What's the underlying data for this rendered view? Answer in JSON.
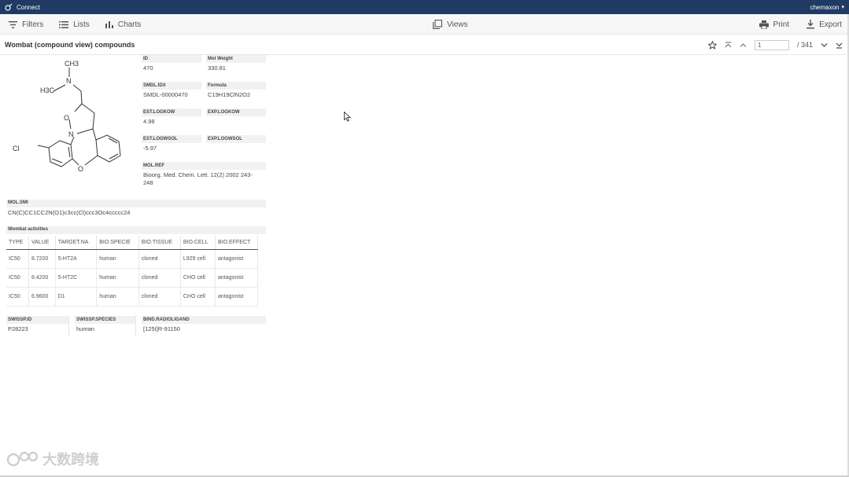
{
  "app": {
    "name": "Connect",
    "user": "chemaxon"
  },
  "toolbar": {
    "filters_label": "Filters",
    "lists_label": "Lists",
    "charts_label": "Charts",
    "views_label": "Views",
    "print_label": "Print",
    "export_label": "Export"
  },
  "view": {
    "title": "Wombat (compound view) compounds",
    "current_page": "1",
    "total_pages": "/ 341"
  },
  "compound": {
    "structure_atoms": {
      "n_top": "N",
      "ch3": "CH3",
      "h3c": "H3C",
      "o_ring": "O",
      "n_ring": "N",
      "cl": "Cl",
      "o_bridge": "O"
    },
    "fields": {
      "id": {
        "label": "ID",
        "value": "470"
      },
      "mol_weight": {
        "label": "Mol Weight",
        "value": "330.81"
      },
      "smdl_idx": {
        "label": "SMDL.IDX",
        "value": "SMDL-00000470"
      },
      "formula": {
        "label": "Formula",
        "value": "C19H19ClN2O2"
      },
      "est_logkow": {
        "label": "EST.LOGKOW",
        "value": "4.98"
      },
      "exp_logkow": {
        "label": "EXP.LOGKOW",
        "value": ""
      },
      "est_logwsol": {
        "label": "EST.LOGWSOL",
        "value": "-5.97"
      },
      "exp_logwsol": {
        "label": "EXP.LOGWSOL",
        "value": ""
      },
      "mol_ref": {
        "label": "MOL.REF",
        "value": "Bioorg. Med. Chem. Lett. 12(2) 2002 243-",
        "value2": "248"
      },
      "mol_smi": {
        "label": "MOL.SMI",
        "value": "CN(C)CC1CC2N(O1)c3cc(Cl)ccc3Oc4ccccc24"
      },
      "swissp_id": {
        "label": "SWISSP.ID",
        "value": "P28223"
      },
      "swissp_species": {
        "label": "SWISSP.SPECIES",
        "value": "human"
      },
      "bind_radioligand": {
        "label": "BIND.RADIOLIGAND",
        "value": "[125I]R-91150"
      }
    },
    "activities": {
      "label": "Wombat activities",
      "columns": [
        "TYPE",
        "VALUE",
        "TARGET.NA",
        "BIO.SPECIE",
        "BIO.TISSUE",
        "BIO.CELL",
        "BIO.EFFECT"
      ],
      "rows": [
        [
          "IC50",
          "8.7200",
          "5-HT2A",
          "human",
          "cloned",
          "L929 cell",
          "antagonist"
        ],
        [
          "IC50",
          "8.4200",
          "5-HT2C",
          "human",
          "cloned",
          "CHO cell",
          "antagonist"
        ],
        [
          "IC50",
          "6.9600",
          "D1",
          "human",
          "cloned",
          "CHO cell",
          "antagonist"
        ]
      ]
    }
  },
  "watermark": {
    "text": "大数跨境"
  },
  "colors": {
    "topbar": "#1f3a63",
    "accent": "#2a5a9a"
  },
  "icons": [
    "connect-logo-icon",
    "filter-icon",
    "list-icon",
    "chart-icon",
    "views-icon",
    "print-icon",
    "export-icon",
    "star-icon",
    "first-page-icon",
    "prev-page-icon",
    "next-page-icon",
    "last-page-icon",
    "cursor-icon"
  ]
}
